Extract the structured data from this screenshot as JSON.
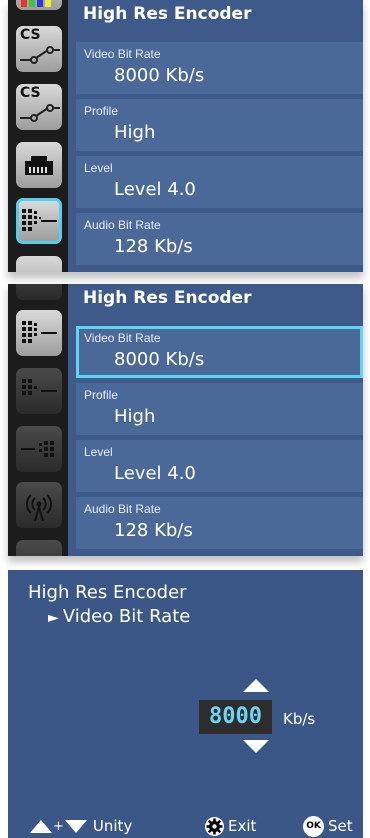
{
  "encoder": {
    "title": "High Res Encoder",
    "rows": [
      {
        "label": "Video Bit Rate",
        "value": "8000 Kb/s"
      },
      {
        "label": "Profile",
        "value": "High"
      },
      {
        "label": "Level",
        "value": "Level 4.0"
      },
      {
        "label": "Audio Bit Rate",
        "value": "128 Kb/s"
      }
    ]
  },
  "sidebar": {
    "cs_label": "CS"
  },
  "editor": {
    "title": "High Res Encoder",
    "subtitle": "Video Bit Rate",
    "subtitle_marker": "►",
    "value": "8000",
    "unit": "Kb/s"
  },
  "footer": {
    "unity_label": "Unity",
    "plus": "+",
    "exit_label": "Exit",
    "set_label": "Set",
    "ok_badge": "OK"
  },
  "colors": {
    "panel_bg": "#3d5a8a",
    "row_bg": "#4a6898",
    "focus_border": "#5fd4f0",
    "value_text": "#6fd4f2"
  }
}
